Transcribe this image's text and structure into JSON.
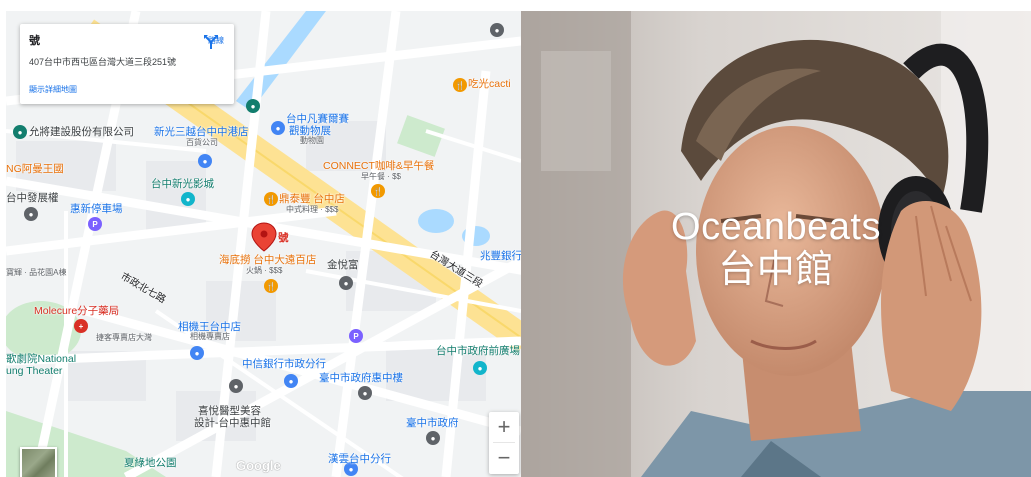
{
  "map": {
    "info_card": {
      "title": "號",
      "address": "407台中市西屯區台灣大道三段251號",
      "directions_label": "路線",
      "view_larger_label": "顯示詳細地圖"
    },
    "marker_label": "號",
    "zoom_in_label": "+",
    "zoom_out_label": "−",
    "google_logo": "Google",
    "labels": [
      {
        "text": "允將建設股份有限公司",
        "cls": ""
      },
      {
        "text": "新光三越台中中港店",
        "cls": "blue"
      },
      {
        "text": "百貨公司",
        "cls": "small"
      },
      {
        "text": "台中凡賽爾賽",
        "cls": "blue"
      },
      {
        "text": "觀動物展",
        "cls": "blue"
      },
      {
        "text": "動物園",
        "cls": "small"
      },
      {
        "text": "NG阿曼王國",
        "cls": "orange"
      },
      {
        "text": "CONNECT咖啡&早午餐",
        "cls": "orange"
      },
      {
        "text": "早午餐 · $$",
        "cls": "small"
      },
      {
        "text": "台中新光影城",
        "cls": "teal"
      },
      {
        "text": "惠新停車場",
        "cls": "blue"
      },
      {
        "text": "鼎泰豐 台中店",
        "cls": "orange"
      },
      {
        "text": "中式料理 · $$$",
        "cls": "small"
      },
      {
        "text": "海底撈 台中大遠百店",
        "cls": "orange"
      },
      {
        "text": "火鍋 · $$$",
        "cls": "small"
      },
      {
        "text": "金悅富",
        "cls": ""
      },
      {
        "text": "台灣大道三段",
        "cls": "road"
      },
      {
        "text": "兆豐銀行",
        "cls": "blue"
      },
      {
        "text": "市政北七路",
        "cls": "road"
      },
      {
        "text": "Molecure分子藥局",
        "cls": "red"
      },
      {
        "text": "相機王台中店",
        "cls": "blue"
      },
      {
        "text": "相機專賣店",
        "cls": "small"
      },
      {
        "text": "歌劇院National",
        "cls": "teal"
      },
      {
        "text": "ung Theater",
        "cls": "teal"
      },
      {
        "text": "中信銀行市政分行",
        "cls": "blue"
      },
      {
        "text": "台中市政府前廣場",
        "cls": "teal"
      },
      {
        "text": "臺中市政府惠中樓",
        "cls": "blue"
      },
      {
        "text": "喜悅醫型美容",
        "cls": ""
      },
      {
        "text": "設計-台中惠中館",
        "cls": ""
      },
      {
        "text": "臺中市政府",
        "cls": "blue"
      },
      {
        "text": "夏綠地公園",
        "cls": "teal"
      },
      {
        "text": "漢雲台中分行",
        "cls": "blue"
      },
      {
        "text": "吃光cacti",
        "cls": "orange"
      },
      {
        "text": "台中發展權",
        "cls": ""
      },
      {
        "text": "寶輝 · 品花園A棟",
        "cls": "small"
      },
      {
        "text": "捷客專賣店大灣",
        "cls": "small"
      }
    ]
  },
  "hero": {
    "title_line1": "Oceanbeats",
    "title_line2": "台中館"
  }
}
